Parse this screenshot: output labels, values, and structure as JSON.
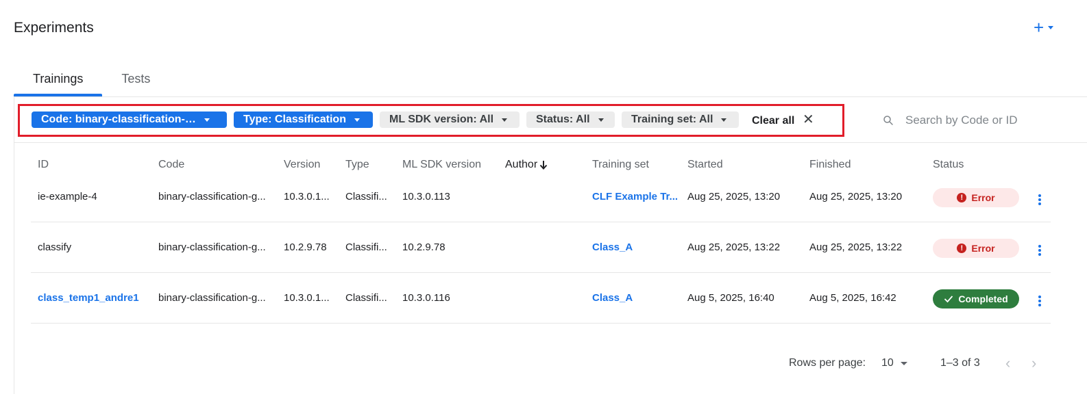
{
  "header": {
    "title": "Experiments",
    "add_icon": "plus-icon",
    "menu_icon": "caret-down-icon"
  },
  "tabs": [
    {
      "label": "Trainings",
      "active": true
    },
    {
      "label": "Tests",
      "active": false
    }
  ],
  "filters": {
    "chips": [
      {
        "label": "Code: binary-classification-…",
        "style": "active"
      },
      {
        "label": "Type: Classification",
        "style": "active"
      },
      {
        "label": "ML SDK version: All",
        "style": "inactive"
      },
      {
        "label": "Status: All",
        "style": "inactive"
      },
      {
        "label": "Training set: All",
        "style": "inactive"
      }
    ],
    "clear_all_label": "Clear all",
    "clear_icon": "close-icon",
    "highlight_color": "#e11d2a"
  },
  "search": {
    "placeholder": "Search by Code or ID",
    "value": "",
    "icon": "search-icon"
  },
  "table": {
    "columns": [
      "ID",
      "Code",
      "Version",
      "Type",
      "ML SDK version",
      "Author",
      "Training set",
      "Started",
      "Finished",
      "Status"
    ],
    "sort_column": "Author",
    "sort_icon": "arrow-down-icon",
    "rows": [
      {
        "id": "ie-example-4",
        "code": "binary-classification-g...",
        "version": "10.3.0.1...",
        "type": "Classifi...",
        "ml_sdk_version": "10.3.0.113",
        "author": "",
        "training_set": "CLF Example Tr...",
        "started": "Aug 25, 2025, 13:20",
        "finished": "Aug 25, 2025, 13:20",
        "status": "Error"
      },
      {
        "id": "classify",
        "code": "binary-classification-g...",
        "version": "10.2.9.78",
        "type": "Classifi...",
        "ml_sdk_version": "10.2.9.78",
        "author": "",
        "training_set": "Class_A",
        "started": "Aug 25, 2025, 13:22",
        "finished": "Aug 25, 2025, 13:22",
        "status": "Error"
      },
      {
        "id": "class_temp1_andre1",
        "code": "binary-classification-g...",
        "version": "10.3.0.1...",
        "type": "Classifi...",
        "ml_sdk_version": "10.3.0.116",
        "author": "",
        "training_set": "Class_A",
        "started": "Aug 5, 2025, 16:40",
        "finished": "Aug 5, 2025, 16:42",
        "status": "Completed"
      }
    ]
  },
  "status_colors": {
    "error_bg": "#fde8e8",
    "error_fg": "#c5221f",
    "completed_bg": "#2e7d3e",
    "completed_fg": "#ffffff",
    "accent": "#1a73e8"
  },
  "pagination": {
    "rows_per_page_label": "Rows per page:",
    "rows_per_page_value": "10",
    "range_label": "1–3 of 3",
    "prev_icon": "chevron-left-icon",
    "next_icon": "chevron-right-icon"
  }
}
